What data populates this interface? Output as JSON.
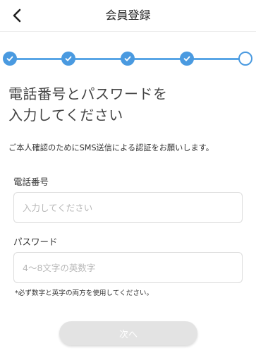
{
  "header": {
    "title": "会員登録"
  },
  "stepper": {
    "total_steps": 5,
    "completed_steps": 4,
    "accent_color": "#4a9ae0"
  },
  "main": {
    "heading_line1": "電話番号とパスワードを",
    "heading_line2": "入力してください",
    "description": "ご本人確認のためにSMS送信による認証をお願いします。"
  },
  "form": {
    "phone": {
      "label": "電話番号",
      "placeholder": "入力してください",
      "value": ""
    },
    "password": {
      "label": "パスワード",
      "placeholder": "4～8文字の英数字",
      "value": ""
    },
    "note": "*必ず数字と英字の両方を使用してください。"
  },
  "actions": {
    "next_label": "次へ",
    "next_enabled": false
  }
}
